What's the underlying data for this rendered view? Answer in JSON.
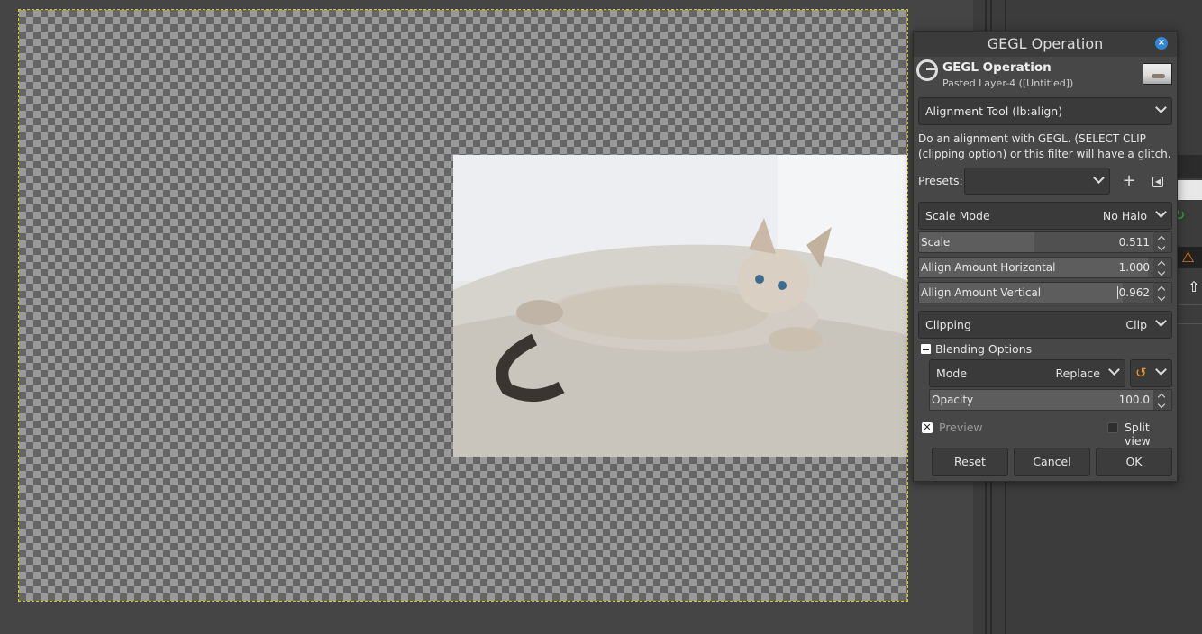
{
  "dialog": {
    "title": "GEGL Operation",
    "header_title": "GEGL Operation",
    "header_subtitle": "Pasted Layer-4 ([Untitled])",
    "operation": "Alignment Tool (lb:align)",
    "description": "Do an alignment with GEGL. (SELECT CLIP (clipping option) or this filter will have a glitch.",
    "presets_label": "Presets:",
    "presets_value": "",
    "scale_mode": {
      "label": "Scale Mode",
      "value": "No Halo"
    },
    "scale": {
      "label": "Scale",
      "value": "0.511",
      "fill": 0.46
    },
    "allign_h": {
      "label": "Allign Amount Horizontal",
      "value": "1.000",
      "fill": 0.9
    },
    "allign_v": {
      "label": "Allign Amount Vertical",
      "value": "0.962",
      "fill": 0.87
    },
    "clipping": {
      "label": "Clipping",
      "value": "Clip"
    },
    "blending_label": "Blending Options",
    "mode": {
      "label": "Mode",
      "value": "Replace"
    },
    "opacity": {
      "label": "Opacity",
      "value": "100.0",
      "fill": 1.0
    },
    "preview_label": "Preview",
    "preview_checked": true,
    "split_view_label": "Split view",
    "split_view_checked": false,
    "reset_label": "Reset",
    "cancel_label": "Cancel",
    "ok_label": "OK"
  },
  "icons": {
    "close": "close-icon",
    "logo": "gegl-logo-icon",
    "add_preset": "plus-icon",
    "preset_menu": "menu-arrow-icon",
    "reset_mode": "undo-icon",
    "warning": "warning-icon",
    "up_arrow": "arrow-up-icon"
  },
  "colors": {
    "accent": "#2f86d6",
    "warning": "#f08a1c",
    "selection": "#d8d000"
  }
}
